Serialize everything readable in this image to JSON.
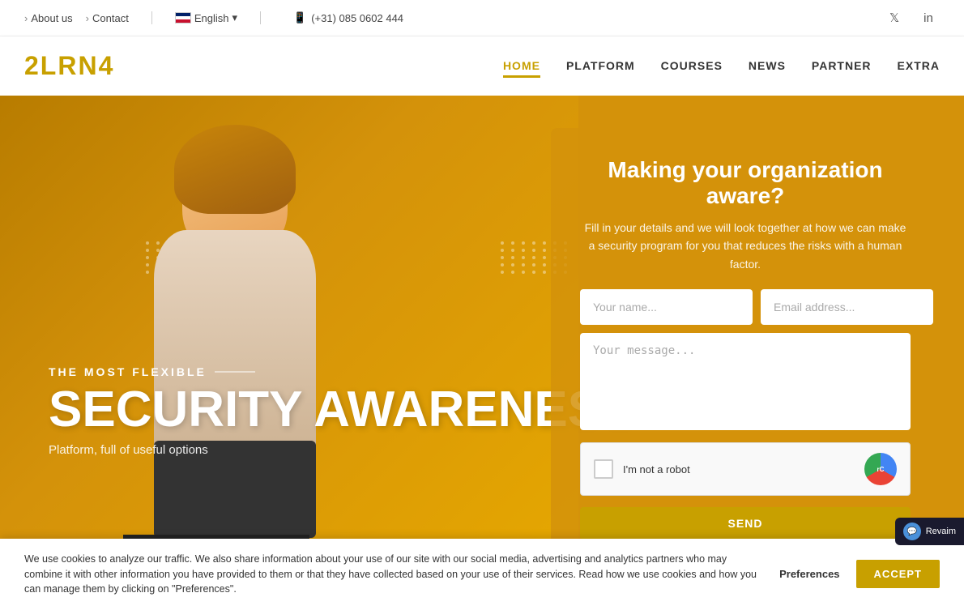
{
  "topbar": {
    "about_label": "About us",
    "contact_label": "Contact",
    "language_label": "English",
    "phone": "(+31) 085 0602 444",
    "phone_icon": "📱"
  },
  "navbar": {
    "logo": "2LRN4",
    "links": [
      {
        "label": "HOME",
        "active": true
      },
      {
        "label": "PLATFORM",
        "active": false
      },
      {
        "label": "COURSES",
        "active": false
      },
      {
        "label": "NEWS",
        "active": false
      },
      {
        "label": "PARTNER",
        "active": false
      },
      {
        "label": "EXTRA",
        "active": false
      }
    ]
  },
  "hero": {
    "subtitle": "THE MOST FLEXIBLE",
    "title_line1": "SECURITY AWARENESS",
    "tagline": "Platform, full of useful options"
  },
  "form": {
    "heading": "Making your organization aware?",
    "description": "Fill in your details and we will look together at how we can make a security program for you that reduces the risks with a human factor.",
    "name_placeholder": "Your name...",
    "email_placeholder": "Email address...",
    "message_placeholder": "Your message...",
    "recaptcha_label": "I'm not a robot",
    "send_label": "Send"
  },
  "cookie": {
    "text": "We use cookies to analyze our traffic. We also share information about your use of our site with our social media, advertising and analytics partners who may combine it with other information you have provided to them or that they have collected based on your use of their services. Read how we use cookies and how you can manage them by clicking on \"Preferences\".",
    "preferences_label": "Preferences",
    "accept_label": "ACCEPT"
  },
  "revaim": {
    "label": "Revaim"
  },
  "social": {
    "twitter": "𝕏",
    "linkedin": "in"
  },
  "colors": {
    "gold": "#c8a000",
    "hero_bg": "#d4920a"
  }
}
